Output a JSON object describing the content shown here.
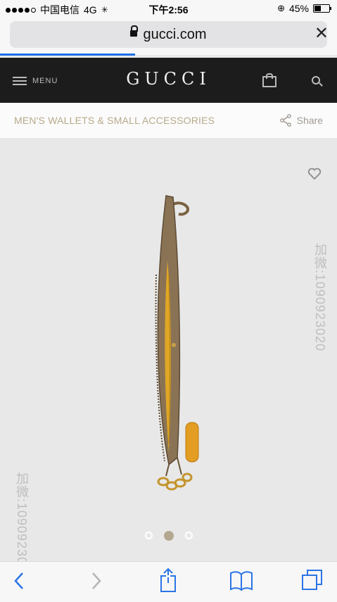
{
  "status_bar": {
    "carrier": "中国电信",
    "network": "4G",
    "time": "下午2:56",
    "battery": "45%",
    "battery_level": 0.45
  },
  "browser": {
    "url": "gucci.com",
    "load_progress": 0.4
  },
  "site_header": {
    "menu_label": "MENU",
    "logo": "GUCCI"
  },
  "category_bar": {
    "title": "MEN'S WALLETS & SMALL ACCESSORIES",
    "share_label": "Share"
  },
  "gallery": {
    "page_count": 3,
    "current_page": 2
  },
  "watermark": {
    "text": "加微:1090923020"
  },
  "toolbar": {
    "items": [
      "back",
      "forward",
      "share",
      "bookmarks",
      "tabs"
    ]
  }
}
